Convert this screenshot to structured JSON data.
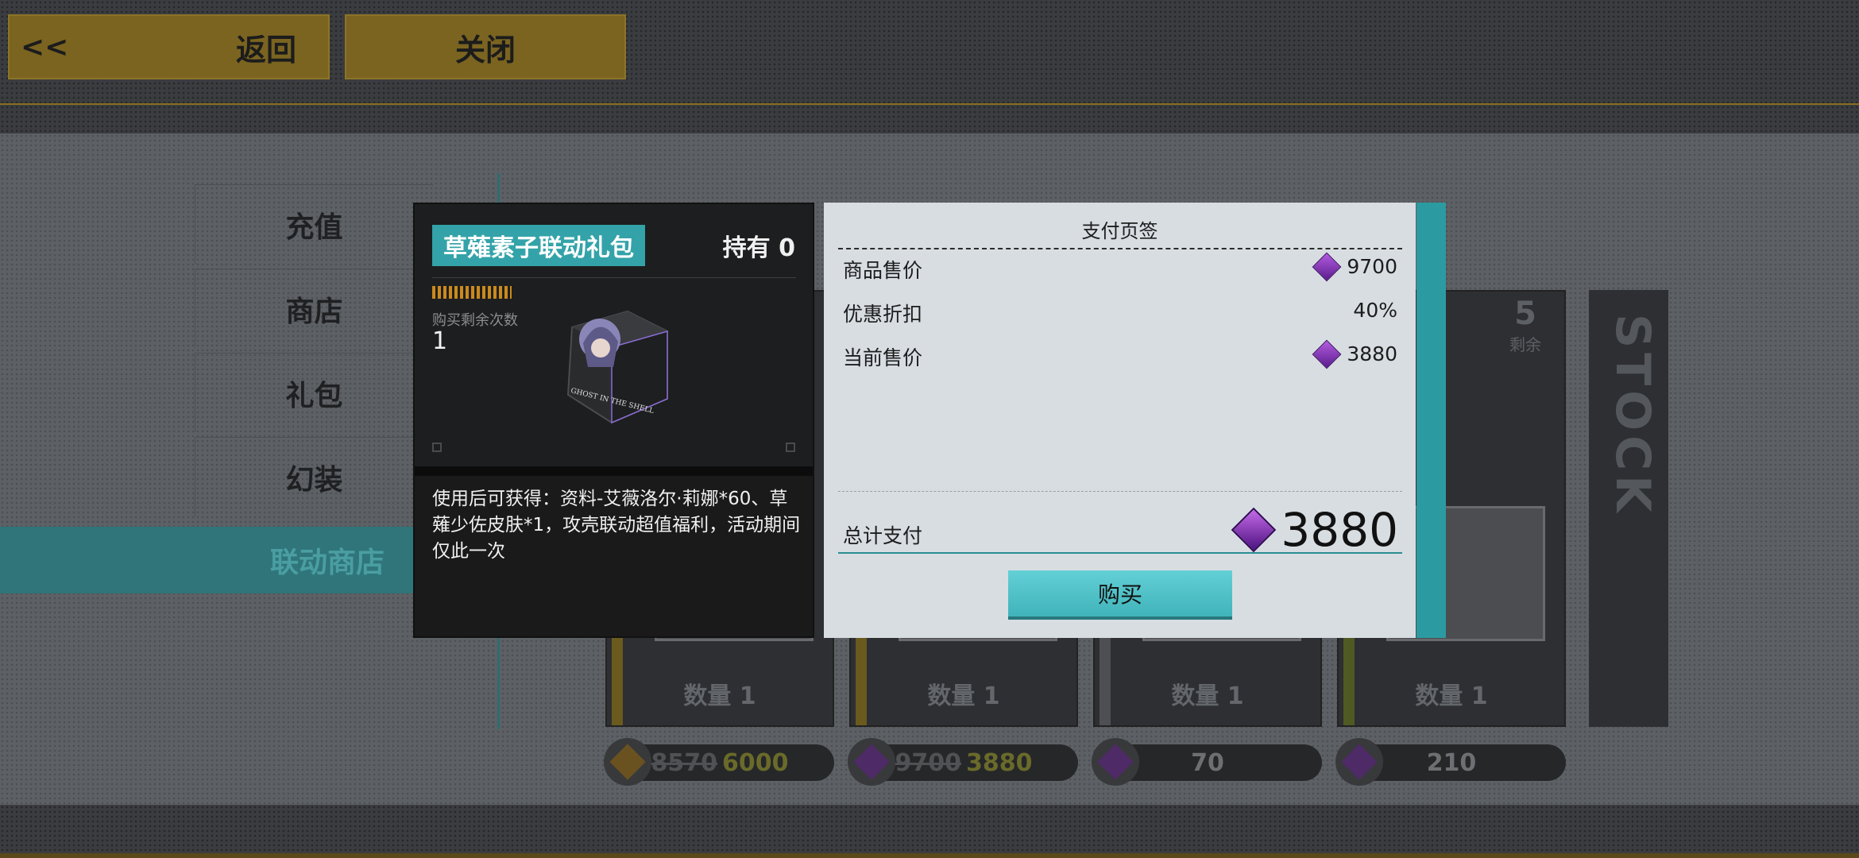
{
  "topbar": {
    "back_arrow": "<<",
    "back_label": "返回",
    "close_label": "关闭"
  },
  "sidebar": {
    "items": [
      {
        "label": "充值"
      },
      {
        "label": "商店"
      },
      {
        "label": "礼包"
      },
      {
        "label": "幻装"
      }
    ],
    "active_label": "联动商店"
  },
  "shop_cards": {
    "quantity_label": "数量 1",
    "remaining_count": "5",
    "remaining_label": "剩余",
    "stock_text": "STOCK",
    "prices": [
      {
        "old": "8570",
        "new": "6000"
      },
      {
        "old": "9700",
        "new": "3880"
      },
      {
        "old": "",
        "new": "70"
      },
      {
        "old": "",
        "new": "210"
      }
    ]
  },
  "item": {
    "name": "草薙素子联动礼包",
    "owned": "持有 0",
    "remaining_label": "购买剩余次数",
    "remaining_count": "1",
    "image_text": "GHOST IN THE SHELL",
    "description": "使用后可获得：资料-艾薇洛尔·莉娜*60、草薙少佐皮肤*1，攻壳联动超值福利，活动期间仅此一次"
  },
  "payment": {
    "title": "支付页签",
    "rows": [
      {
        "label": "商品售价",
        "value": "9700"
      },
      {
        "label": "优惠折扣",
        "value": "40%"
      },
      {
        "label": "当前售价",
        "value": "3880"
      }
    ],
    "total_label": "总计支付",
    "total_value": "3880",
    "buy_label": "购买"
  },
  "colors": {
    "accent_teal": "#33a3a9",
    "top_button_gold": "#7a6420",
    "gem_purple": "#8a3cc0"
  }
}
